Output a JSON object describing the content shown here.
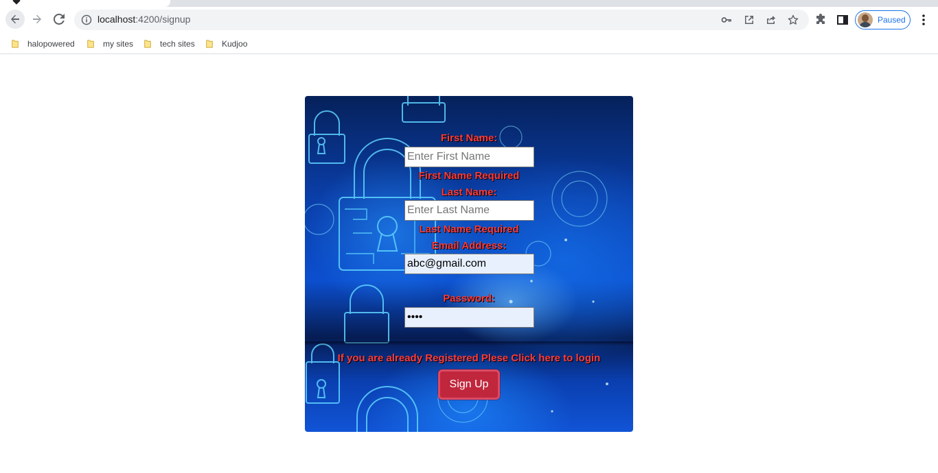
{
  "browser": {
    "url_host": "localhost",
    "url_path": ":4200/signup",
    "profile_status": "Paused",
    "bookmarks": [
      {
        "label": "halopowered",
        "icon": "folder-icon"
      },
      {
        "label": "my sites",
        "icon": "folder-icon"
      },
      {
        "label": "tech sites",
        "icon": "folder-icon"
      },
      {
        "label": "Kudjoo",
        "icon": "folder-icon"
      }
    ]
  },
  "form": {
    "first_name": {
      "label": "First Name:",
      "placeholder": "Enter First Name",
      "value": "",
      "error": "First Name Required"
    },
    "last_name": {
      "label": "Last Name:",
      "placeholder": "Enter Last Name",
      "value": "",
      "error": "Last Name Required"
    },
    "email": {
      "label": "Email Address:",
      "value": "abc@gmail.com"
    },
    "password": {
      "label": "Password:",
      "value": "1234"
    },
    "login_link": "If you are already Registered Plese Click here to login",
    "submit_label": "Sign Up"
  },
  "colors": {
    "label_red": "#ff3b3b",
    "button_red": "#c0263c",
    "card_blue": "#0c4fcf",
    "autofill_blue": "#e8f0fe"
  }
}
